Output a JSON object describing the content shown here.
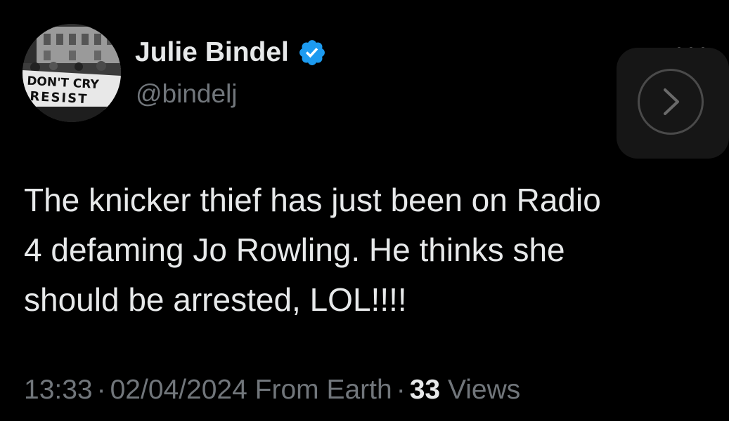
{
  "tweet": {
    "author": {
      "display_name": "Julie Bindel",
      "handle": "@bindelj",
      "verified": true,
      "avatar_sign_text": [
        "DON'T CRY",
        "RESIST"
      ]
    },
    "lines": [
      "The knicker thief has just been on Radio",
      "4 defaming Jo Rowling. He thinks she",
      "should be arrested, LOL!!!!"
    ],
    "meta": {
      "time": "13:33",
      "separator": "·",
      "date": "02/04/2024",
      "source": "From Earth",
      "views_count": "33",
      "views_label": "Views"
    }
  },
  "icons": {
    "verified": "verified-badge-icon",
    "more": "more-horizontal-icon",
    "share": "chevron-right-icon"
  },
  "colors": {
    "background": "#000000",
    "primary_text": "#e7e9ea",
    "secondary_text": "#71767b",
    "verified_blue": "#1d9bf0",
    "tile": "#161616"
  }
}
